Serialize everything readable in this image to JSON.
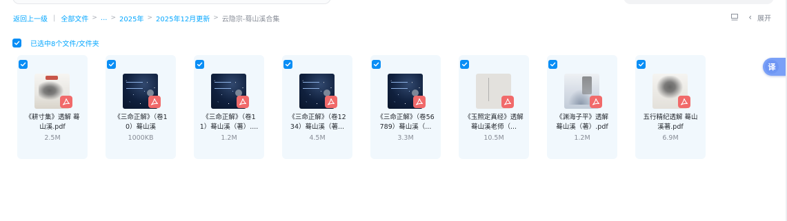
{
  "breadcrumb": {
    "back": "返回上一级",
    "all_files": "全部文件",
    "ellipsis": "...",
    "year": "2025年",
    "month": "2025年12月更新",
    "current": "云隐宗-蓦山溪合集"
  },
  "tools": {
    "list_icon": "list-view-icon",
    "expand_label": "展开"
  },
  "selection": {
    "text": "已选中8个文件/文件夹",
    "checked": true
  },
  "translate": {
    "label": "译"
  },
  "files": [
    {
      "name": "《耕寸集》透解 蓦山溪.pdf",
      "size": "2.5M",
      "thumb": "ink",
      "checked": true
    },
    {
      "name": "《三命正解》（卷10）蓦山溪",
      "size": "1000KB",
      "thumb": "dark",
      "checked": true
    },
    {
      "name": "《三命正解》（卷11）蓦山溪（著）....",
      "size": "1.2M",
      "thumb": "dark",
      "checked": true
    },
    {
      "name": "《三命正解》（卷1234）蓦山溪（著...",
      "size": "4.5M",
      "thumb": "dark",
      "checked": true
    },
    {
      "name": "《三命正解》（卷56789）蓦山溪（...",
      "size": "3.3M",
      "thumb": "dark",
      "checked": true
    },
    {
      "name": "《玉照定真经》透解 蓦山溪老师（...",
      "size": "10.5M",
      "thumb": "paper",
      "checked": true
    },
    {
      "name": "《渊海子平》透解 蓦山溪（著）.pdf",
      "size": "1.2M",
      "thumb": "mist",
      "checked": true
    },
    {
      "name": "五行精纪透解 蓦山溪著.pdf",
      "size": "6.9M",
      "thumb": "ink2",
      "checked": true
    }
  ],
  "colors": {
    "accent": "#06a7ff",
    "checkbox": "#0a8ef5",
    "card_bg": "#f1f8fd",
    "pdf_badge": "#f16a6a"
  }
}
